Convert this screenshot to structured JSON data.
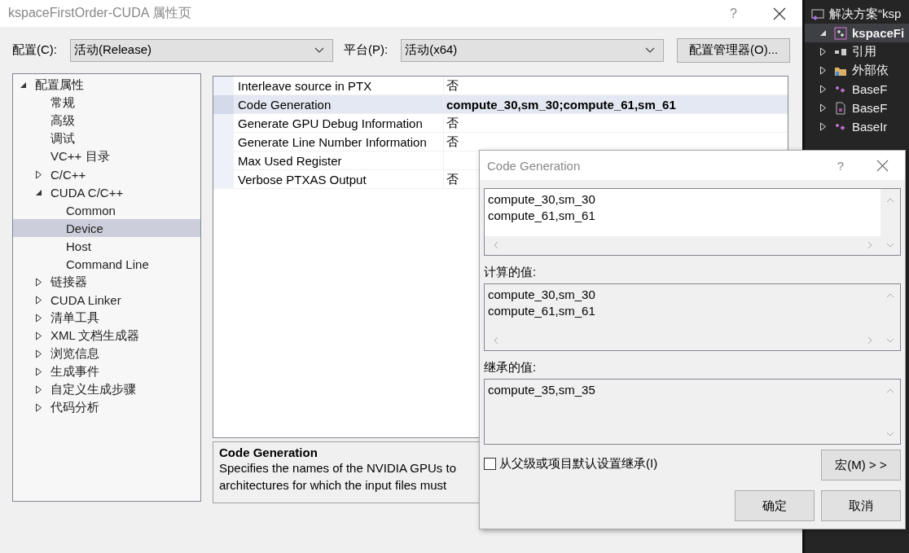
{
  "window": {
    "title": "kspaceFirstOrder-CUDA 属性页",
    "help": "?"
  },
  "config": {
    "label": "配置(C):",
    "value": "活动(Release)"
  },
  "platform": {
    "label": "平台(P):",
    "value": "活动(x64)"
  },
  "config_manager_button": "配置管理器(O)...",
  "tree": [
    {
      "label": "配置属性",
      "expanded": true,
      "selected": false,
      "children": [
        {
          "label": "常规",
          "selected": false
        },
        {
          "label": "高级",
          "selected": false
        },
        {
          "label": "调试",
          "selected": false
        },
        {
          "label": "VC++ 目录",
          "selected": false
        },
        {
          "label": "C/C++",
          "expanded": false,
          "selected": false
        },
        {
          "label": "CUDA C/C++",
          "expanded": true,
          "selected": false,
          "children": [
            {
              "label": "Common",
              "selected": false
            },
            {
              "label": "Device",
              "selected": true
            },
            {
              "label": "Host",
              "selected": false
            },
            {
              "label": "Command Line",
              "selected": false
            }
          ]
        },
        {
          "label": "链接器",
          "expanded": false,
          "selected": false
        },
        {
          "label": "CUDA Linker",
          "expanded": false,
          "selected": false
        },
        {
          "label": "清单工具",
          "expanded": false,
          "selected": false
        },
        {
          "label": "XML 文档生成器",
          "expanded": false,
          "selected": false
        },
        {
          "label": "浏览信息",
          "expanded": false,
          "selected": false
        },
        {
          "label": "生成事件",
          "expanded": false,
          "selected": false
        },
        {
          "label": "自定义生成步骤",
          "expanded": false,
          "selected": false
        },
        {
          "label": "代码分析",
          "expanded": false,
          "selected": false
        }
      ]
    }
  ],
  "properties": [
    {
      "name": "Interleave source in PTX",
      "value": "否",
      "selected": false
    },
    {
      "name": "Code Generation",
      "value": "compute_30,sm_30;compute_61,sm_61",
      "selected": true,
      "modified": true
    },
    {
      "name": "Generate GPU Debug Information",
      "value": "否",
      "selected": false
    },
    {
      "name": "Generate Line Number Information",
      "value": "否",
      "selected": false
    },
    {
      "name": "Max Used Register",
      "selected": false
    },
    {
      "name": "Verbose PTXAS Output",
      "value": "否",
      "selected": false
    }
  ],
  "description": {
    "title": "Code Generation",
    "lines": [
      "Specifies the names of the NVIDIA GPUs to",
      "architectures for which the input files must"
    ]
  },
  "solution_explorer": [
    {
      "label": "解决方案“ksp",
      "kind": "solution",
      "selected": false
    },
    {
      "label": "kspaceFi",
      "kind": "project",
      "selected": true,
      "expanded": true
    },
    {
      "label": "引用",
      "kind": "references",
      "selected": false,
      "expanded": false
    },
    {
      "label": "外部依",
      "kind": "folder",
      "selected": false,
      "expanded": false
    },
    {
      "label": "BaseF",
      "kind": "cpp",
      "selected": false,
      "expanded": false
    },
    {
      "label": "BaseF",
      "kind": "header",
      "selected": false,
      "expanded": false
    },
    {
      "label": "BaseIr",
      "kind": "cpp",
      "selected": false,
      "expanded": false
    }
  ],
  "dialog": {
    "title": "Code Generation",
    "help": "?",
    "value_lines": [
      "compute_30,sm_30",
      "compute_61,sm_61"
    ],
    "computed_label": "计算的值:",
    "computed_lines": [
      "compute_30,sm_30",
      "compute_61,sm_61"
    ],
    "inherited_label": "继承的值:",
    "inherited_lines": [
      "compute_35,sm_35"
    ],
    "inherit": {
      "label": "从父级或项目默认设置继承(I)",
      "checked": false
    },
    "macro_button": "宏(M) > >",
    "ok_button": "确定",
    "cancel_button": "取消"
  }
}
